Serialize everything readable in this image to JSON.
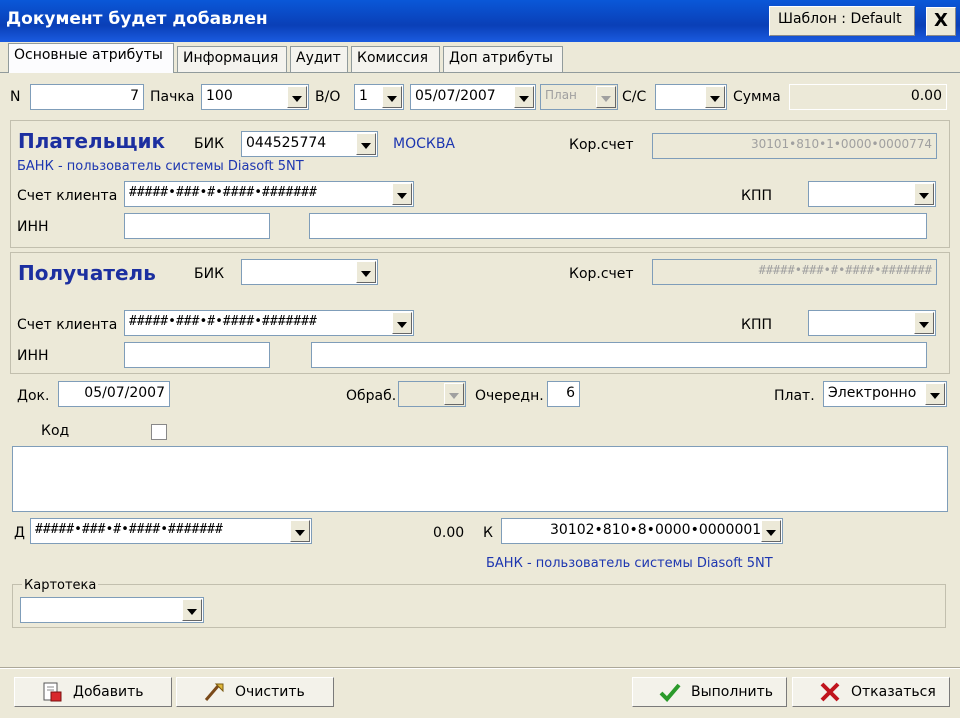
{
  "window": {
    "title": "Документ будет добавлен",
    "template_label": "Шаблон : Default",
    "close_label": "X"
  },
  "tabs": [
    "Основные атрибуты",
    "Информация",
    "Аудит",
    "Комиссия",
    "Доп атрибуты"
  ],
  "header": {
    "n_label": "N",
    "n_value": "7",
    "pack_label": "Пачка",
    "pack_value": "100",
    "vo_label": "В/О",
    "vo_value": "1",
    "date_value": "05/07/2007",
    "plan_value": "План",
    "cs_label": "С/С",
    "cs_value": "",
    "sum_label": "Сумма",
    "sum_value": "0.00"
  },
  "payer": {
    "title": "Плательщик",
    "bik_label": "БИК",
    "bik_value": "044525774",
    "city": "МОСКВА",
    "kor_label": "Кор.счет",
    "kor_value": "30101•810•1•0000•0000774",
    "bank_name": "БАНК - пользователь системы Diasoft 5NT",
    "account_label": "Счет клиента",
    "account_value": "#####•###•#•####•#######",
    "kpp_label": "КПП",
    "inn_label": "ИНН"
  },
  "receiver": {
    "title": "Получатель",
    "bik_label": "БИК",
    "bik_value": "",
    "kor_label": "Кор.счет",
    "kor_value": "#####•###•#•####•#######",
    "account_label": "Счет клиента",
    "account_value": "#####•###•#•####•#######",
    "kpp_label": "КПП",
    "inn_label": "ИНН"
  },
  "doc": {
    "doc_label": "Док.",
    "doc_date": "05/07/2007",
    "obrab_label": "Обраб.",
    "queue_label": "Очередн.",
    "queue_value": "6",
    "plat_label": "Плат.",
    "plat_value": "Электронно",
    "code_label": "Код"
  },
  "posting": {
    "d_label": "Д",
    "d_value": "#####•###•#•####•#######",
    "amount": "0.00",
    "k_label": "К",
    "k_value": "30102•810•8•0000•0000001",
    "k_bank": "БАНК - пользователь системы Diasoft 5NT"
  },
  "kartoteka": {
    "label": "Картотека",
    "value": ""
  },
  "buttons": {
    "add": "Добавить",
    "clear": "Очистить",
    "execute": "Выполнить",
    "cancel": "Отказаться"
  },
  "colors": {
    "title_bar": "#0a3fb7",
    "window_bg": "#ece9d8",
    "section_title": "#1c2fa0",
    "ok_check": "#2a9a2a",
    "cancel_x": "#c0141c"
  }
}
